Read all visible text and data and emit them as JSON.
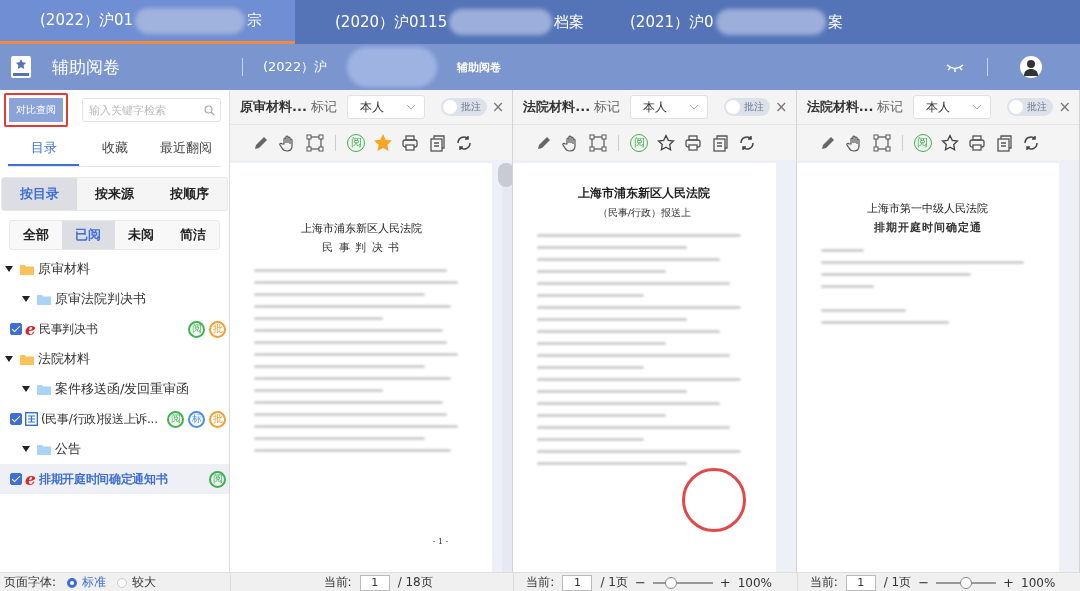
{
  "tabs": [
    {
      "label_start": "(2022）沪01",
      "label_end": "宗",
      "selected": true
    },
    {
      "label_start": "(2020）沪0115",
      "label_end": "档案",
      "selected": false
    },
    {
      "label_start": "(2021）沪0",
      "label_end": "案",
      "selected": false
    }
  ],
  "header": {
    "title": "辅助阅卷",
    "case_start": "(2022）沪",
    "subtitle": "辅助阅卷"
  },
  "sidebar": {
    "compare_button": "对比查阅",
    "search": {
      "placeholder": "输入关键字检索"
    },
    "tabs": [
      {
        "label": "目录",
        "selected": true
      },
      {
        "label": "收藏",
        "selected": false
      },
      {
        "label": "最近翻阅",
        "selected": false
      }
    ],
    "modes": [
      {
        "label": "按目录",
        "selected": true
      },
      {
        "label": "按来源",
        "selected": false
      },
      {
        "label": "按顺序",
        "selected": false
      }
    ],
    "filters": [
      {
        "label": "全部",
        "selected": false
      },
      {
        "label": "已阅",
        "selected": true
      },
      {
        "label": "未阅",
        "selected": false
      },
      {
        "label": "简洁",
        "selected": false
      }
    ],
    "tree": [
      {
        "kind": "folder",
        "label": "原审材料",
        "expanded": true,
        "children": [
          {
            "kind": "subfolder",
            "label": "原审法院判决书",
            "expanded": true,
            "children": [
              {
                "kind": "ebook",
                "icon_text": "e",
                "label": "民事判决书",
                "checked": true,
                "selected": false,
                "badges": [
                  {
                    "text": "阅",
                    "color": "#3cb44b"
                  },
                  {
                    "text": "批",
                    "color": "#f0a030"
                  }
                ]
              }
            ]
          }
        ]
      },
      {
        "kind": "folder",
        "label": "法院材料",
        "expanded": true,
        "children": [
          {
            "kind": "subfolder",
            "label": "案件移送函/发回重审函",
            "expanded": true,
            "children": [
              {
                "kind": "form",
                "label": "(民事/行政)报送上诉...",
                "checked": true,
                "selected": false,
                "badges": [
                  {
                    "text": "阅",
                    "color": "#3cb44b"
                  },
                  {
                    "text": "标",
                    "color": "#4a8ee6"
                  },
                  {
                    "text": "批",
                    "color": "#f0a030"
                  }
                ]
              }
            ]
          },
          {
            "kind": "subfolder",
            "label": "公告",
            "expanded": true,
            "children": [
              {
                "kind": "ebook",
                "icon_text": "e",
                "label": "排期开庭时间确定通知书",
                "checked": true,
                "selected": true,
                "badges": [
                  {
                    "text": "阅",
                    "color": "#3cb44b"
                  }
                ]
              }
            ]
          }
        ]
      }
    ]
  },
  "panels": [
    {
      "title": "原审材料...",
      "mark_label": "标记",
      "owner": "本人",
      "close": "×",
      "annotate": {
        "label": "批注",
        "on": false
      },
      "read_badge": "阅",
      "starred": true,
      "document": {
        "kind": "judgment",
        "lines": [
          "上海市浦东新区人民法院",
          "民 事 判 决 书",
          "- 1 -"
        ]
      },
      "footer": {
        "current_label": "当前:",
        "page": "1",
        "total": "/ 18页"
      }
    },
    {
      "title": "法院材料...",
      "mark_label": "标记",
      "owner": "本人",
      "close": "×",
      "annotate": {
        "label": "批注",
        "on": false
      },
      "read_badge": "阅",
      "starred": false,
      "document": {
        "kind": "form",
        "lines": [
          "上海市浦东新区人民法院",
          "（民事/行政）报送上"
        ]
      },
      "footer": {
        "current_label": "当前:",
        "page": "1",
        "total": "/ 1页",
        "zoom": {
          "minus": "−",
          "plus": "+",
          "level": 0.3,
          "reading": "100%"
        }
      }
    },
    {
      "title": "法院材料...",
      "mark_label": "标记",
      "owner": "本人",
      "close": "×",
      "annotate": {
        "label": "批注",
        "on": false
      },
      "read_badge": "阅",
      "starred": false,
      "document": {
        "kind": "notice",
        "lines": [
          "上海市第一中级人民法院",
          "排期开庭时间确定通"
        ]
      },
      "footer": {
        "current_label": "当前:",
        "page": "1",
        "total": "/ 1页",
        "zoom": {
          "minus": "−",
          "plus": "+",
          "level": 0.5,
          "reading": "100%"
        }
      }
    }
  ],
  "font_setting": {
    "label": "页面字体:",
    "options": [
      {
        "label": "标准",
        "selected": true
      },
      {
        "label": "较大",
        "selected": false
      }
    ]
  }
}
